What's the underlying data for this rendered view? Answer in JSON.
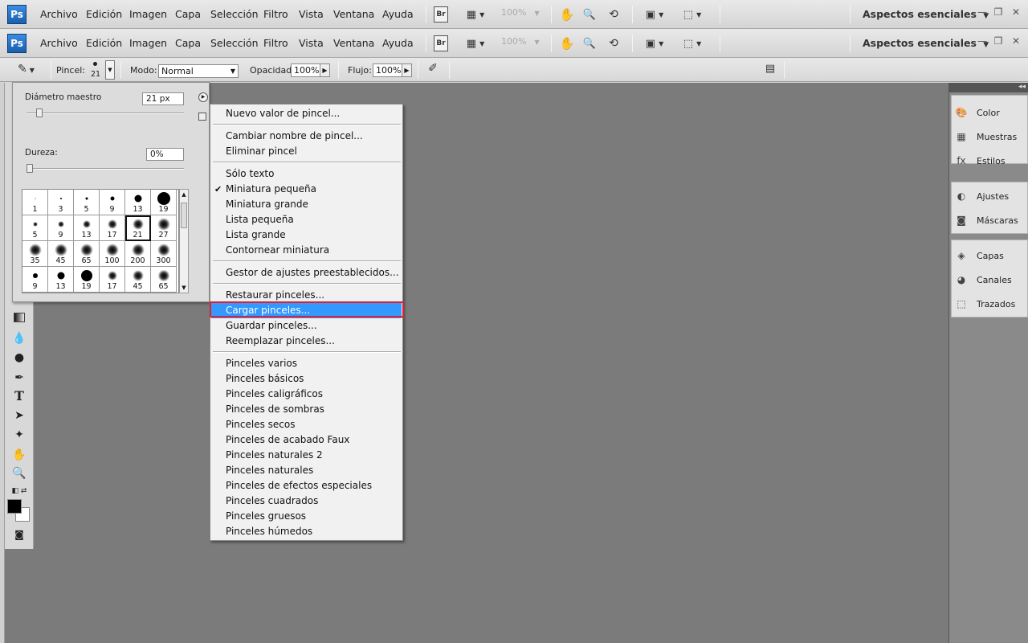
{
  "app": {
    "logo": "Ps",
    "menus": [
      "Archivo",
      "Edición",
      "Imagen",
      "Capa",
      "Selección",
      "Filtro",
      "Vista",
      "Ventana",
      "Ayuda"
    ],
    "bridge_label": "Br",
    "zoom_value": "100%",
    "workspace": "Aspectos esenciales",
    "workspace_arrow": "▼"
  },
  "options_bar": {
    "brush_label": "Pincel:",
    "brush_size": "21",
    "mode_label": "Modo:",
    "mode_value": "Normal",
    "opacity_label": "Opacidad:",
    "opacity_value": "100%",
    "flow_label": "Flujo:",
    "flow_value": "100%"
  },
  "brush_picker": {
    "master_diameter_label": "Diámetro maestro",
    "master_diameter_value": "21 px",
    "master_diameter_slider": 0.08,
    "hardness_label": "Dureza:",
    "hardness_value": "0%",
    "hardness_slider": 0,
    "presets": [
      {
        "size": "1",
        "dot": 1,
        "soft": false
      },
      {
        "size": "3",
        "dot": 2,
        "soft": false
      },
      {
        "size": "5",
        "dot": 3,
        "soft": false
      },
      {
        "size": "9",
        "dot": 5,
        "soft": false
      },
      {
        "size": "13",
        "dot": 9,
        "soft": false
      },
      {
        "size": "19",
        "dot": 16,
        "soft": false
      },
      {
        "size": "5",
        "dot": 2,
        "soft": true
      },
      {
        "size": "9",
        "dot": 4,
        "soft": true
      },
      {
        "size": "13",
        "dot": 6,
        "soft": true
      },
      {
        "size": "17",
        "dot": 8,
        "soft": true
      },
      {
        "size": "21",
        "dot": 10,
        "soft": true
      },
      {
        "size": "27",
        "dot": 12,
        "soft": true
      },
      {
        "size": "35",
        "dot": 12,
        "soft": true
      },
      {
        "size": "45",
        "dot": 12,
        "soft": true
      },
      {
        "size": "65",
        "dot": 12,
        "soft": true
      },
      {
        "size": "100",
        "dot": 12,
        "soft": true
      },
      {
        "size": "200",
        "dot": 12,
        "soft": true
      },
      {
        "size": "300",
        "dot": 12,
        "soft": true
      },
      {
        "size": "9",
        "dot": 6,
        "soft": false
      },
      {
        "size": "13",
        "dot": 9,
        "soft": false
      },
      {
        "size": "19",
        "dot": 14,
        "soft": false
      },
      {
        "size": "17",
        "dot": 8,
        "soft": true
      },
      {
        "size": "45",
        "dot": 10,
        "soft": true
      },
      {
        "size": "65",
        "dot": 11,
        "soft": true
      }
    ],
    "selected_index": 10
  },
  "context_menu": [
    {
      "label": "Nuevo valor de pincel..."
    },
    {
      "sep": true
    },
    {
      "label": "Cambiar nombre de pincel..."
    },
    {
      "label": "Eliminar pincel"
    },
    {
      "sep": true
    },
    {
      "label": "Sólo texto"
    },
    {
      "label": "Miniatura pequeña",
      "checked": true
    },
    {
      "label": "Miniatura grande"
    },
    {
      "label": "Lista pequeña"
    },
    {
      "label": "Lista grande"
    },
    {
      "label": "Contornear miniatura"
    },
    {
      "sep": true
    },
    {
      "label": "Gestor de ajustes preestablecidos..."
    },
    {
      "sep": true
    },
    {
      "label": "Restaurar pinceles..."
    },
    {
      "label": "Cargar pinceles...",
      "highlighted": true
    },
    {
      "label": "Guardar pinceles..."
    },
    {
      "label": "Reemplazar pinceles..."
    },
    {
      "sep": true
    },
    {
      "label": "Pinceles varios"
    },
    {
      "label": "Pinceles básicos"
    },
    {
      "label": "Pinceles caligráficos"
    },
    {
      "label": "Pinceles de sombras"
    },
    {
      "label": "Pinceles secos"
    },
    {
      "label": "Pinceles de acabado Faux"
    },
    {
      "label": "Pinceles naturales 2"
    },
    {
      "label": "Pinceles naturales"
    },
    {
      "label": "Pinceles de efectos especiales"
    },
    {
      "label": "Pinceles cuadrados"
    },
    {
      "label": "Pinceles gruesos"
    },
    {
      "label": "Pinceles húmedos"
    }
  ],
  "right_panels": {
    "collapse_glyph": "◂◂",
    "groups": [
      [
        {
          "label": "Color",
          "icon": "palette-icon"
        },
        {
          "label": "Muestras",
          "icon": "swatches-icon"
        },
        {
          "label": "Estilos",
          "icon": "fx-icon"
        }
      ],
      [
        {
          "label": "Ajustes",
          "icon": "adjustments-icon"
        },
        {
          "label": "Máscaras",
          "icon": "masks-icon"
        }
      ],
      [
        {
          "label": "Capas",
          "icon": "layers-icon"
        },
        {
          "label": "Canales",
          "icon": "channels-icon"
        },
        {
          "label": "Trazados",
          "icon": "paths-icon"
        }
      ]
    ]
  }
}
